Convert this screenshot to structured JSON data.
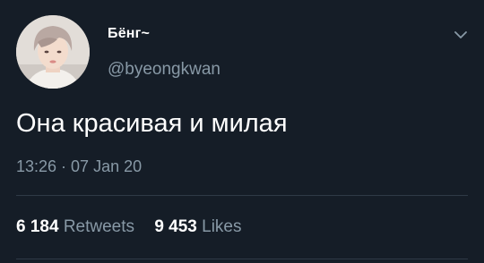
{
  "tweet": {
    "author": {
      "display_name": "Бёнг~",
      "handle": "@byeongkwan",
      "avatar": "avatar-photo"
    },
    "menu_icon": "chevron-down-icon",
    "text": "Она красивая и милая",
    "timestamp": "13:26 · 07 Jan 20",
    "stats": {
      "retweets_count": "6 184",
      "retweets_label": "Retweets",
      "likes_count": "9 453",
      "likes_label": "Likes"
    }
  },
  "colors": {
    "background": "#151d27",
    "primary_text": "#ffffff",
    "secondary_text": "#8899a6",
    "divider": "#2f3a46"
  }
}
